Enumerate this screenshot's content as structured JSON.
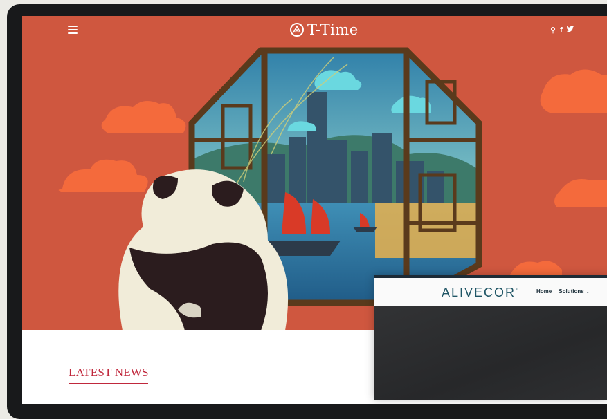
{
  "site": {
    "name": "T-Time",
    "menu_icon": "hamburger-menu-icon",
    "nav_icons": [
      "search-icon",
      "facebook-icon",
      "twitter-icon"
    ],
    "icon_glyphs": {
      "search": "⚲",
      "facebook": "f",
      "twitter": "✓"
    }
  },
  "news": {
    "heading": "LATEST NEWS"
  },
  "overlay": {
    "brand": "ALIVECOR",
    "brand_mark": "°",
    "nav": [
      {
        "label": "Home"
      },
      {
        "label": "Solutions"
      }
    ],
    "dropdown_icon": "chevron-down-icon"
  },
  "colors": {
    "hero_bg": "#cf573f",
    "accent": "#c0283c",
    "cloud": "#f46a3c",
    "frame": "#5a3a1c",
    "alive_brand": "#1f5565"
  }
}
